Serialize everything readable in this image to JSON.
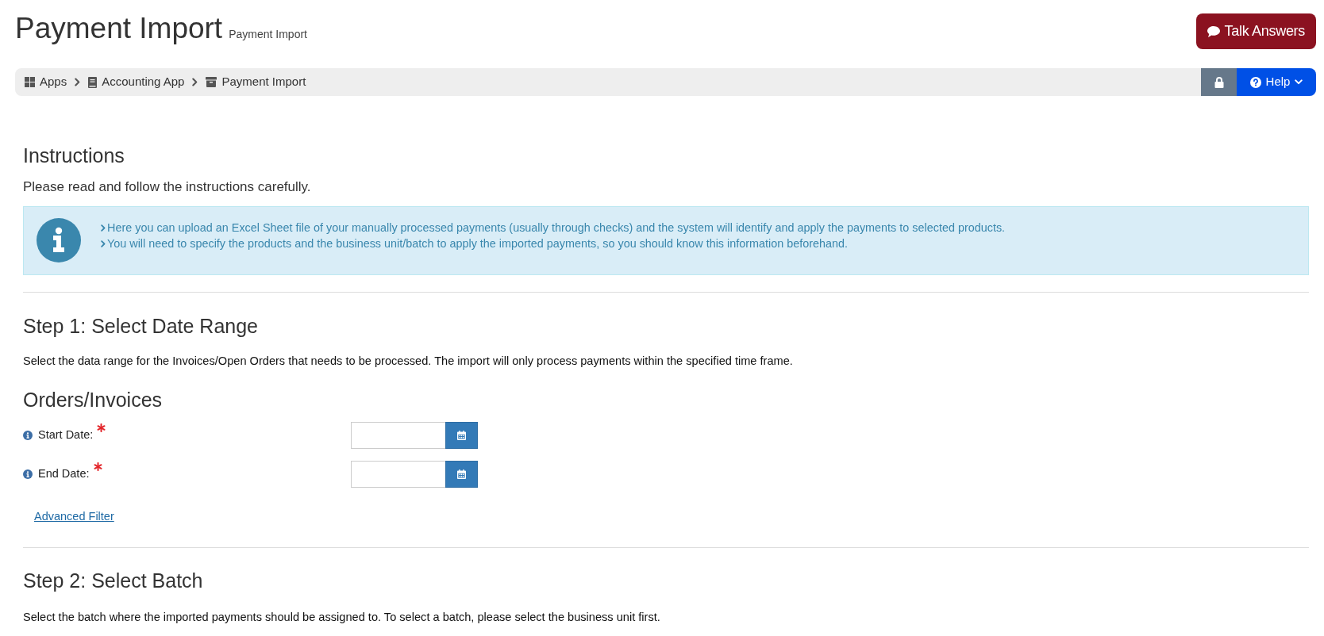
{
  "header": {
    "title": "Payment Import",
    "subtitle": "Payment Import",
    "talk_button": "Talk Answers"
  },
  "breadcrumb": [
    {
      "label": "Apps"
    },
    {
      "label": "Accounting App"
    },
    {
      "label": "Payment Import"
    }
  ],
  "toolbar": {
    "help_button": "Help"
  },
  "instructions": {
    "heading": "Instructions",
    "intro": "Please read and follow the instructions carefully.",
    "notes": [
      "Here you can upload an Excel Sheet file of your manually processed payments (usually through checks) and the system will identify and apply the payments to selected products.",
      "You will need to specify the products and the business unit/batch to apply the imported payments, so you should know this information beforehand."
    ]
  },
  "step1": {
    "heading": "Step 1: Select Date Range",
    "description": "Select the data range for the Invoices/Open Orders that needs to be processed. The import will only process payments within the specified time frame.",
    "group_heading": "Orders/Invoices",
    "fields": [
      {
        "label": "Start Date:",
        "required": true
      },
      {
        "label": "End Date:",
        "required": true
      }
    ],
    "advanced_filter_link": "Advanced Filter"
  },
  "step2": {
    "heading": "Step 2: Select Batch",
    "description": "Select the batch where the imported payments should be assigned to. To select a batch, please select the business unit first."
  }
}
